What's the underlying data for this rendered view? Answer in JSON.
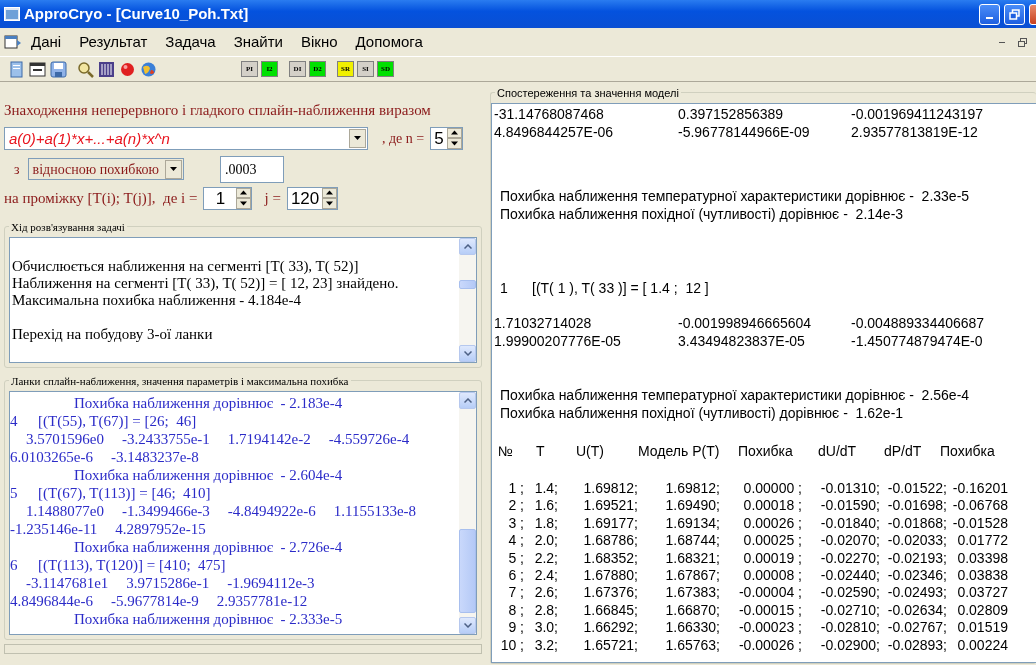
{
  "window": {
    "title": "ApproCryo - [Curve10_Poh.Txt]"
  },
  "menu": [
    {
      "label": "Дані"
    },
    {
      "label": "Результат"
    },
    {
      "label": "Задача"
    },
    {
      "label": "Знайти"
    },
    {
      "label": "Вікно"
    },
    {
      "label": "Допомога"
    }
  ],
  "mode_buttons": [
    {
      "label": "PI",
      "color": "#d4d0c8"
    },
    {
      "label": "I2",
      "color": "#00e000"
    },
    {
      "label": "DI",
      "color": "#d4d0c8"
    },
    {
      "label": "D2",
      "color": "#00e000"
    },
    {
      "label": "SR",
      "color": "#f0f000"
    },
    {
      "label": "SI",
      "color": "#d4d0c8"
    },
    {
      "label": "SD",
      "color": "#00e000"
    }
  ],
  "form": {
    "heading": "Знаходження неперервного і гладкого сплайн-наближення виразом",
    "formula": "a(0)+a(1)*x+...+a(n)*x^n",
    "n_label": ", де n =",
    "n": "5",
    "with_label": "з",
    "error_mode": "відносною похибкою",
    "tolerance": ".0003",
    "range_label": "на проміжку [T(i); T(j)],  де i =",
    "i": "1",
    "j_label": "j =",
    "j": "120"
  },
  "progress": {
    "legend": "Хід розв'язування задачі",
    "paragraphs": [
      [
        "Обчислюється наближення на сегменті [T( 33), T( 52)]",
        "Наближення на сегменті [T( 33), T( 52)] = [ 12, 23]  знайдено.",
        "Максимальна похибка наближення - 4.184e-4"
      ],
      [
        "Перехід на побудову 3-ої ланки"
      ]
    ]
  },
  "segments": {
    "legend": "Ланки сплайн-наближення, значення параметрів і максимальна похибка",
    "lines": [
      {
        "kind": "error",
        "text": "Похибка наближення дорівнює  - 2.183e-4"
      },
      {
        "kind": "segment",
        "number": "4",
        "range": "[(T(55), T(67)] = [26;  46]"
      },
      {
        "kind": "coefficients",
        "values": [
          "3.5701596e0",
          "-3.2433755e-1",
          "1.7194142e-2",
          "-4.559726e-4"
        ]
      },
      {
        "kind": "continuation",
        "values": [
          "6.0103265e-6",
          "-3.1483237e-8"
        ]
      },
      {
        "kind": "error",
        "text": "Похибка наближення дорівнює  - 2.604e-4"
      },
      {
        "kind": "segment",
        "number": "5",
        "range": "[(T(67), T(113)] = [46;  410]"
      },
      {
        "kind": "coefficients",
        "values": [
          "1.1488077e0",
          "-1.3499466e-3",
          "-4.8494922e-6",
          "1.1155133e-8"
        ]
      },
      {
        "kind": "continuation",
        "values": [
          "-1.235146e-11",
          "4.2897952e-15"
        ]
      },
      {
        "kind": "error",
        "text": "Похибка наближення дорівнює  - 2.726e-4"
      },
      {
        "kind": "segment",
        "number": "6",
        "range": "[(T(113), T(120)] = [410;  475]"
      },
      {
        "kind": "coefficients",
        "values": [
          "-3.1147681e1",
          "3.9715286e-1",
          "-1.9694112e-3"
        ]
      },
      {
        "kind": "continuation",
        "values": [
          "4.8496844e-6",
          "-5.9677814e-9",
          "2.9357781e-12"
        ]
      },
      {
        "kind": "error",
        "text": "Похибка наближення дорівнює  - 2.333e-5"
      }
    ]
  },
  "results": {
    "legend": "Спостереження та значення моделі",
    "blocks": [
      {
        "kind": "coefficients",
        "rows": [
          [
            "-31.14768087468",
            "0.397152856389",
            "-0.001969411243197"
          ],
          [
            "4.8496844257E-06",
            "-5.96778144966E-09",
            "2.93577813819E-12"
          ]
        ]
      },
      {
        "kind": "errors",
        "lines": [
          "Похибка наближення температурної характеристики дорівнює -  2.33e-5",
          "Похибка наближення похідної (чутливості) дорівнює -  2.14e-3"
        ]
      },
      {
        "kind": "segment",
        "number": "1",
        "range": "[(T( 1 ), T( 33 )] = [ 1.4 ;  12 ]"
      },
      {
        "kind": "coefficients",
        "rows": [
          [
            "1.71032714028",
            "-0.001998946665604",
            "-0.004889334406687"
          ],
          [
            "1.99900207776E-05",
            "3.43494823837E-05",
            "-1.450774879474E-0"
          ]
        ]
      },
      {
        "kind": "errors",
        "lines": [
          "Похибка наближення температурної характеристики дорівнює -  2.56e-4",
          "Похибка наближення похідної (чутливості) дорівнює -  1.62e-1"
        ]
      },
      {
        "kind": "table",
        "columns": [
          "№",
          "T",
          "U(T)",
          "Модель P(T)",
          "Похибка",
          "dU/dT",
          "dP/dT",
          "Похибка"
        ],
        "rows": [
          [
            "1 ;",
            "1.4;",
            "1.69812;",
            "1.69812;",
            "0.00000 ;",
            "-0.01310;",
            "-0.01522;",
            "-0.16201"
          ],
          [
            "2 ;",
            "1.6;",
            "1.69521;",
            "1.69490;",
            "0.00018 ;",
            "-0.01590;",
            "-0.01698;",
            "-0.06768"
          ],
          [
            "3 ;",
            "1.8;",
            "1.69177;",
            "1.69134;",
            "0.00026 ;",
            "-0.01840;",
            "-0.01868;",
            "-0.01528"
          ],
          [
            "4 ;",
            "2.0;",
            "1.68786;",
            "1.68744;",
            "0.00025 ;",
            "-0.02070;",
            "-0.02033;",
            "0.01772"
          ],
          [
            "5 ;",
            "2.2;",
            "1.68352;",
            "1.68321;",
            "0.00019 ;",
            "-0.02270;",
            "-0.02193;",
            "0.03398"
          ],
          [
            "6 ;",
            "2.4;",
            "1.67880;",
            "1.67867;",
            "0.00008 ;",
            "-0.02440;",
            "-0.02346;",
            "0.03838"
          ],
          [
            "7 ;",
            "2.6;",
            "1.67376;",
            "1.67383;",
            "-0.00004 ;",
            "-0.02590;",
            "-0.02493;",
            "0.03727"
          ],
          [
            "8 ;",
            "2.8;",
            "1.66845;",
            "1.66870;",
            "-0.00015 ;",
            "-0.02710;",
            "-0.02634;",
            "0.02809"
          ],
          [
            "9 ;",
            "3.0;",
            "1.66292;",
            "1.66330;",
            "-0.00023 ;",
            "-0.02810;",
            "-0.02767;",
            "0.01519"
          ],
          [
            "10 ;",
            "3.2;",
            "1.65721;",
            "1.65763;",
            "-0.00026 ;",
            "-0.02900;",
            "-0.02893;",
            "0.00224"
          ]
        ]
      }
    ]
  }
}
